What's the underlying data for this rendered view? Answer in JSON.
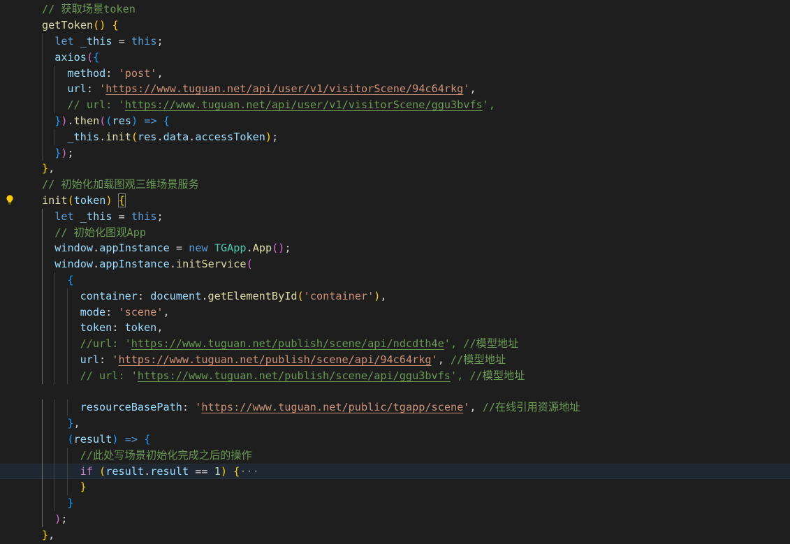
{
  "colors": {
    "background": "#1e1e1e",
    "comment": "#6a9955",
    "keyword": "#569cd6",
    "function": "#dcdcaa",
    "variable": "#9cdcfe",
    "string": "#ce9178",
    "bracket_level_1": "#ffd700",
    "bracket_level_2": "#da70d6",
    "bracket_level_3": "#179fff",
    "lightbulb": "#ffcc00"
  },
  "icons": {
    "gutter": "lightbulb-icon"
  },
  "lines": [
    [
      [
        "cm",
        "// 获取场景token"
      ]
    ],
    [
      [
        "fn",
        "getToken"
      ],
      [
        "b1",
        "()"
      ],
      [
        "pl",
        " "
      ],
      [
        "b1",
        "{"
      ]
    ],
    [
      [
        "kw",
        "let"
      ],
      [
        "pl",
        " "
      ],
      [
        "var",
        "_this"
      ],
      [
        "pl",
        " = "
      ],
      [
        "kw",
        "this"
      ],
      [
        "pl",
        ";"
      ]
    ],
    [
      [
        "var",
        "axios"
      ],
      [
        "b2",
        "("
      ],
      [
        "b3",
        "{"
      ]
    ],
    [
      [
        "var",
        "method"
      ],
      [
        "pl",
        ": "
      ],
      [
        "str",
        "'post'"
      ],
      [
        "pl",
        ","
      ]
    ],
    [
      [
        "var",
        "url"
      ],
      [
        "pl",
        ": "
      ],
      [
        "str",
        "'"
      ],
      [
        "url",
        "https://www.tuguan.net/api/user/v1/visitorScene/94c64rkg"
      ],
      [
        "str",
        "'"
      ],
      [
        "pl",
        ","
      ]
    ],
    [
      [
        "cm",
        "// url: '"
      ],
      [
        "curl",
        "https://www.tuguan.net/api/user/v1/visitorScene/ggu3bvfs"
      ],
      [
        "cm",
        "',"
      ]
    ],
    [
      [
        "b3",
        "}"
      ],
      [
        "b2",
        ")"
      ],
      [
        "pl",
        "."
      ],
      [
        "fn",
        "then"
      ],
      [
        "b2",
        "("
      ],
      [
        "b3",
        "("
      ],
      [
        "var",
        "res"
      ],
      [
        "b3",
        ")"
      ],
      [
        "pl",
        " "
      ],
      [
        "kw",
        "=>"
      ],
      [
        "pl",
        " "
      ],
      [
        "b3",
        "{"
      ]
    ],
    [
      [
        "var",
        "_this"
      ],
      [
        "pl",
        "."
      ],
      [
        "fn",
        "init"
      ],
      [
        "b1",
        "("
      ],
      [
        "var",
        "res"
      ],
      [
        "pl",
        "."
      ],
      [
        "var",
        "data"
      ],
      [
        "pl",
        "."
      ],
      [
        "var",
        "accessToken"
      ],
      [
        "b1",
        ")"
      ],
      [
        "pl",
        ";"
      ]
    ],
    [
      [
        "b3",
        "}"
      ],
      [
        "b2",
        ")"
      ],
      [
        "pl",
        ";"
      ]
    ],
    [
      [
        "b1",
        "}"
      ],
      [
        "pl",
        ","
      ]
    ],
    [
      [
        "cm",
        "// 初始化加载图观三维场景服务"
      ]
    ],
    [
      [
        "fn",
        "init"
      ],
      [
        "b1",
        "("
      ],
      [
        "var",
        "token"
      ],
      [
        "b1",
        ")"
      ],
      [
        "pl",
        " "
      ],
      [
        "b1 match",
        "{"
      ]
    ],
    [
      [
        "kw",
        "let"
      ],
      [
        "pl",
        " "
      ],
      [
        "var",
        "_this"
      ],
      [
        "pl",
        " = "
      ],
      [
        "kw",
        "this"
      ],
      [
        "pl",
        ";"
      ]
    ],
    [
      [
        "cm",
        "// 初始化图观App"
      ]
    ],
    [
      [
        "var",
        "window"
      ],
      [
        "pl",
        "."
      ],
      [
        "var",
        "appInstance"
      ],
      [
        "pl",
        " = "
      ],
      [
        "kw",
        "new"
      ],
      [
        "pl",
        " "
      ],
      [
        "cls",
        "TGApp"
      ],
      [
        "pl",
        "."
      ],
      [
        "fn",
        "App"
      ],
      [
        "b2",
        "()"
      ],
      [
        "pl",
        ";"
      ]
    ],
    [
      [
        "var",
        "window"
      ],
      [
        "pl",
        "."
      ],
      [
        "var",
        "appInstance"
      ],
      [
        "pl",
        "."
      ],
      [
        "fn",
        "initService"
      ],
      [
        "b2",
        "("
      ]
    ],
    [
      [
        "b3",
        "{"
      ]
    ],
    [
      [
        "var",
        "container"
      ],
      [
        "pl",
        ": "
      ],
      [
        "var",
        "document"
      ],
      [
        "pl",
        "."
      ],
      [
        "fn",
        "getElementById"
      ],
      [
        "b1",
        "("
      ],
      [
        "str",
        "'container'"
      ],
      [
        "b1",
        ")"
      ],
      [
        "pl",
        ","
      ]
    ],
    [
      [
        "var",
        "mode"
      ],
      [
        "pl",
        ": "
      ],
      [
        "str",
        "'scene'"
      ],
      [
        "pl",
        ","
      ]
    ],
    [
      [
        "var",
        "token"
      ],
      [
        "pl",
        ": "
      ],
      [
        "var",
        "token"
      ],
      [
        "pl",
        ","
      ]
    ],
    [
      [
        "cm",
        "//url: '"
      ],
      [
        "curl",
        "https://www.tuguan.net/publish/scene/api/ndcdth4e"
      ],
      [
        "cm",
        "', //模型地址"
      ]
    ],
    [
      [
        "var",
        "url"
      ],
      [
        "pl",
        ": "
      ],
      [
        "str",
        "'"
      ],
      [
        "url",
        "https://www.tuguan.net/publish/scene/api/94c64rkg"
      ],
      [
        "str",
        "'"
      ],
      [
        "pl",
        ", "
      ],
      [
        "cm",
        "//模型地址"
      ]
    ],
    [
      [
        "cm",
        "// url: '"
      ],
      [
        "curl",
        "https://www.tuguan.net/publish/scene/api/ggu3bvfs"
      ],
      [
        "cm",
        "', //模型地址"
      ]
    ],
    [],
    [
      [
        "var",
        "resourceBasePath"
      ],
      [
        "pl",
        ": "
      ],
      [
        "str",
        "'"
      ],
      [
        "url",
        "https://www.tuguan.net/public/tgapp/scene"
      ],
      [
        "str",
        "'"
      ],
      [
        "pl",
        ", "
      ],
      [
        "cm",
        "//在线引用资源地址"
      ]
    ],
    [
      [
        "b3",
        "}"
      ],
      [
        "pl",
        ","
      ]
    ],
    [
      [
        "b3",
        "("
      ],
      [
        "var",
        "result"
      ],
      [
        "b3",
        ")"
      ],
      [
        "pl",
        " "
      ],
      [
        "kw",
        "=>"
      ],
      [
        "pl",
        " "
      ],
      [
        "b3",
        "{"
      ]
    ],
    [
      [
        "cm",
        "//此处写场景初始化完成之后的操作"
      ]
    ],
    [
      [
        "ctl",
        "if"
      ],
      [
        "pl",
        " "
      ],
      [
        "b1",
        "("
      ],
      [
        "var",
        "result"
      ],
      [
        "pl",
        "."
      ],
      [
        "var",
        "result"
      ],
      [
        "pl",
        " == "
      ],
      [
        "num",
        "1"
      ],
      [
        "b1",
        ")"
      ],
      [
        "pl",
        " "
      ],
      [
        "b1",
        "{"
      ],
      [
        "fold",
        "···"
      ]
    ],
    [
      [
        "b1",
        "}"
      ]
    ],
    [
      [
        "b3",
        "}"
      ]
    ],
    [
      [
        "b2",
        ")"
      ],
      [
        "pl",
        ";"
      ]
    ],
    [
      [
        "b1",
        "}"
      ],
      [
        "pl",
        ","
      ]
    ]
  ]
}
